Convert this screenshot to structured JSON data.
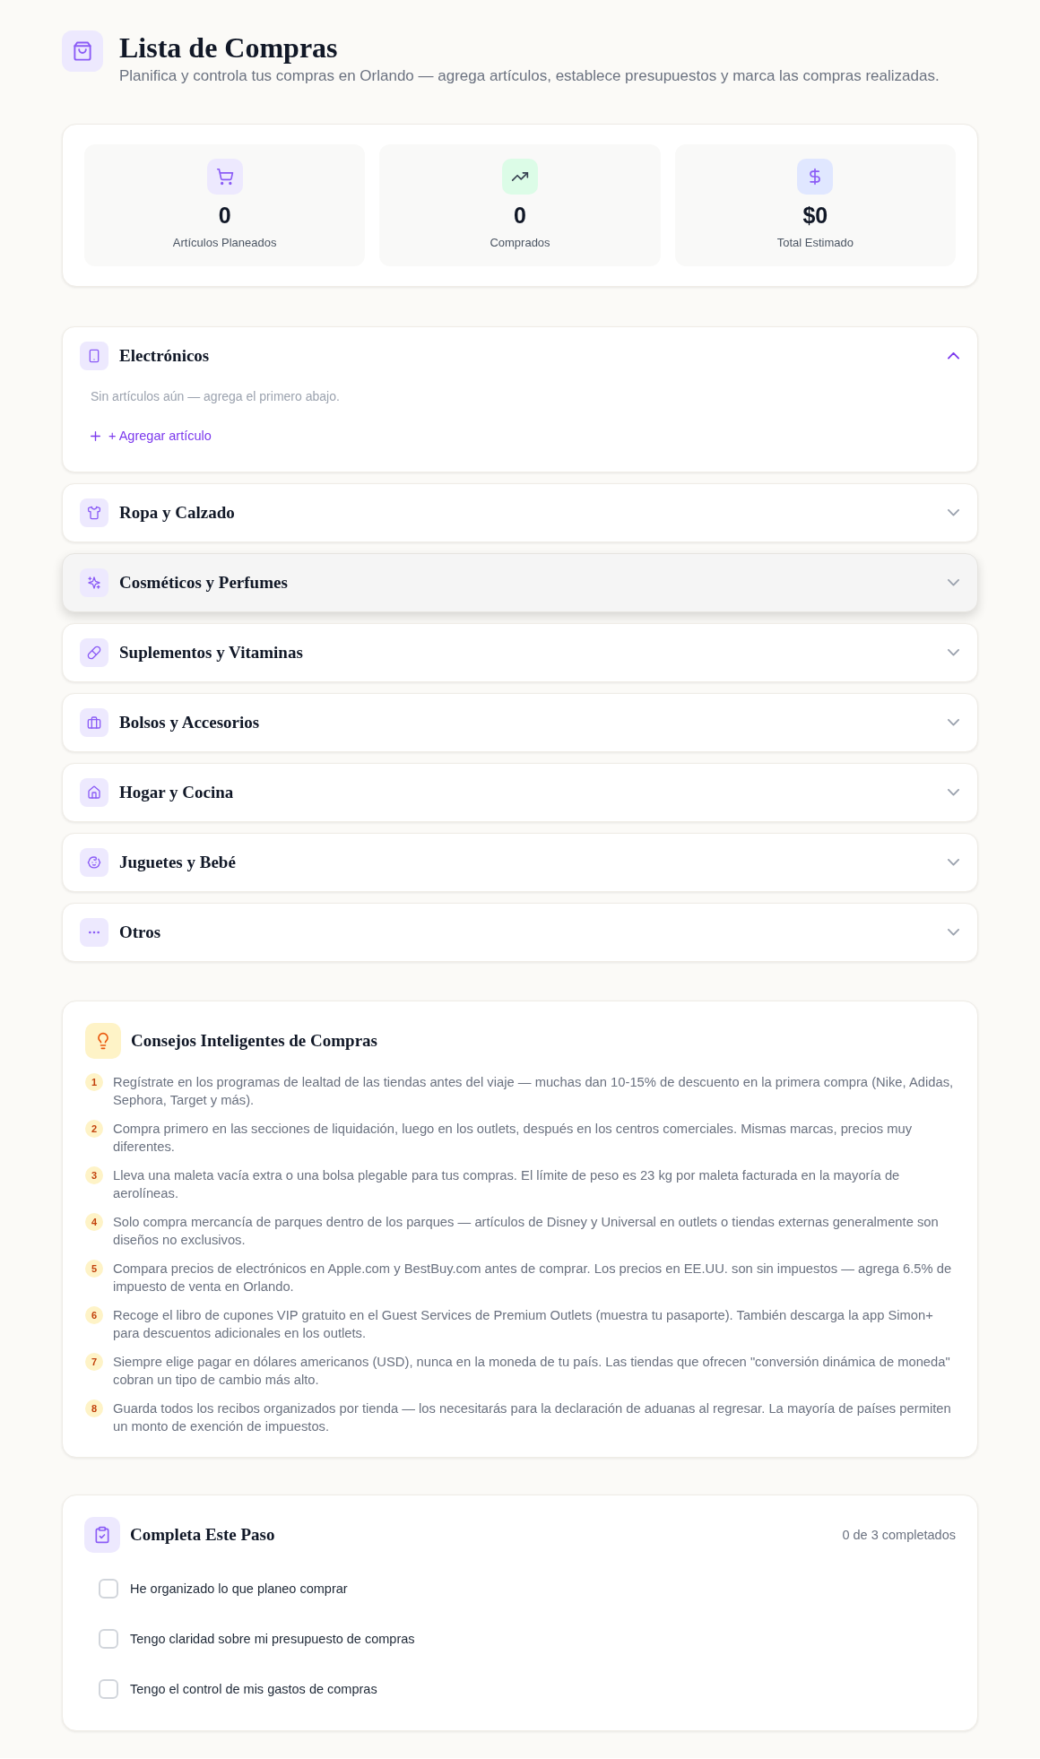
{
  "header": {
    "title": "Lista de Compras",
    "subtitle": "Planifica y controla tus compras en Orlando — agrega artículos, establece presupuestos y marca las compras realizadas."
  },
  "stats": [
    {
      "kind": "cart",
      "value": "0",
      "label": "Artículos Planeados"
    },
    {
      "kind": "trend",
      "value": "0",
      "label": "Comprados"
    },
    {
      "kind": "dollar",
      "value": "$0",
      "label": "Total Estimado"
    }
  ],
  "categories": [
    {
      "kind": "phone",
      "name": "Electrónicos",
      "expanded": true,
      "hovered": false,
      "empty_message": "Sin artículos aún — agrega el primero abajo.",
      "add_label": "+ Agregar artículo"
    },
    {
      "kind": "shirt",
      "name": "Ropa y Calzado",
      "expanded": false,
      "hovered": false
    },
    {
      "kind": "sparkles",
      "name": "Cosméticos y Perfumes",
      "expanded": false,
      "hovered": true
    },
    {
      "kind": "pill",
      "name": "Suplementos y Vitaminas",
      "expanded": false,
      "hovered": false
    },
    {
      "kind": "briefcase",
      "name": "Bolsos y Accesorios",
      "expanded": false,
      "hovered": false
    },
    {
      "kind": "house",
      "name": "Hogar y Cocina",
      "expanded": false,
      "hovered": false
    },
    {
      "kind": "baby",
      "name": "Juguetes y Bebé",
      "expanded": false,
      "hovered": false
    },
    {
      "kind": "dots",
      "name": "Otros",
      "expanded": false,
      "hovered": false
    }
  ],
  "tips": {
    "title": "Consejos Inteligentes de Compras",
    "items": [
      {
        "number": "1",
        "text": "Regístrate en los programas de lealtad de las tiendas antes del viaje — muchas dan 10-15% de descuento en la primera compra (Nike, Adidas, Sephora, Target y más)."
      },
      {
        "number": "2",
        "text": "Compra primero en las secciones de liquidación, luego en los outlets, después en los centros comerciales. Mismas marcas, precios muy diferentes."
      },
      {
        "number": "3",
        "text": "Lleva una maleta vacía extra o una bolsa plegable para tus compras. El límite de peso es 23 kg por maleta facturada en la mayoría de aerolíneas."
      },
      {
        "number": "4",
        "text": "Solo compra mercancía de parques dentro de los parques — artículos de Disney y Universal en outlets o tiendas externas generalmente son diseños no exclusivos."
      },
      {
        "number": "5",
        "text": "Compara precios de electrónicos en Apple.com y BestBuy.com antes de comprar. Los precios en EE.UU. son sin impuestos — agrega 6.5% de impuesto de venta en Orlando."
      },
      {
        "number": "6",
        "text": "Recoge el libro de cupones VIP gratuito en el Guest Services de Premium Outlets (muestra tu pasaporte). También descarga la app Simon+ para descuentos adicionales en los outlets."
      },
      {
        "number": "7",
        "text": "Siempre elige pagar en dólares americanos (USD), nunca en la moneda de tu país. Las tiendas que ofrecen \"conversión dinámica de moneda\" cobran un tipo de cambio más alto."
      },
      {
        "number": "8",
        "text": "Guarda todos los recibos organizados por tienda — los necesitarás para la declaración de aduanas al regresar. La mayoría de países permiten un monto de exención de impuestos."
      }
    ]
  },
  "checklist": {
    "title": "Completa Este Paso",
    "progress": "0 de 3 completados",
    "items": [
      {
        "label": "He organizado lo que planeo comprar",
        "checked": false
      },
      {
        "label": "Tengo claridad sobre mi presupuesto de compras",
        "checked": false
      },
      {
        "label": "Tengo el control de mis gastos de compras",
        "checked": false
      }
    ]
  }
}
